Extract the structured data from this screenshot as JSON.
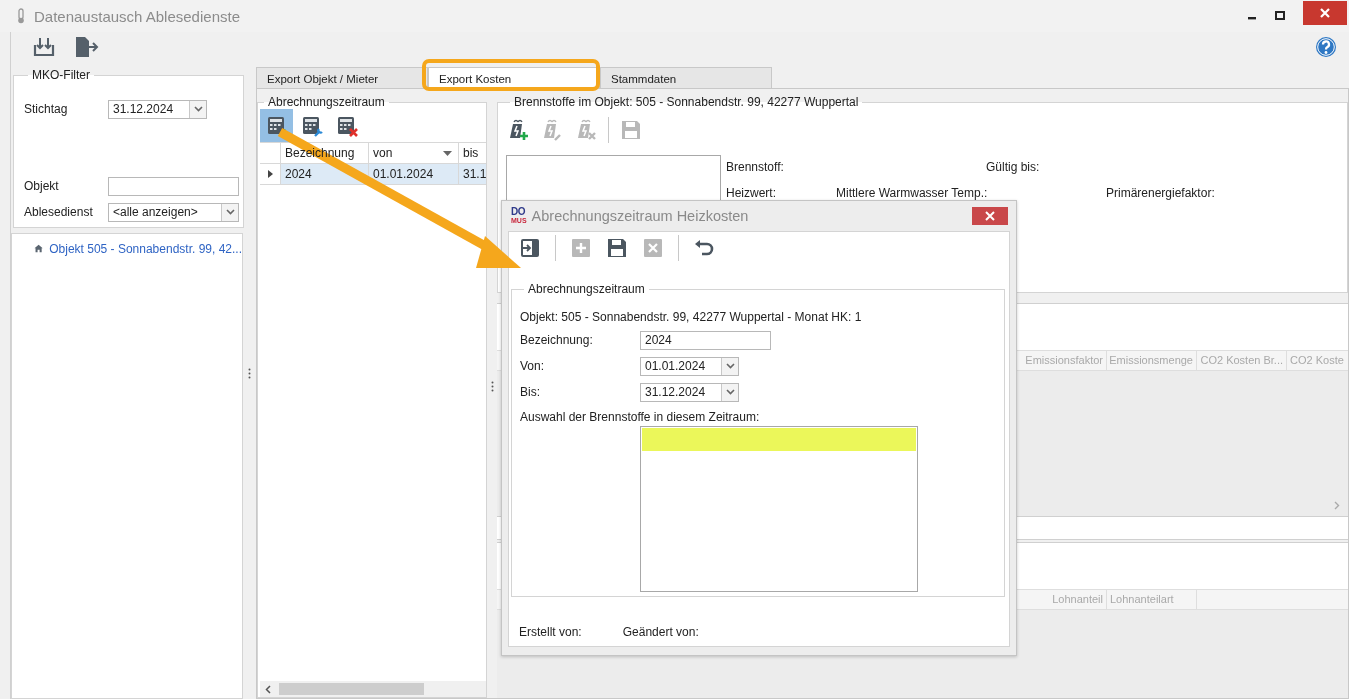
{
  "window": {
    "title": "Datenaustausch Ablesedienste"
  },
  "toolbar": [
    {
      "kind": "import"
    },
    {
      "kind": "export"
    }
  ],
  "filter": {
    "title": "MKO-Filter",
    "fields": [
      {
        "label": "Stichtag",
        "value": "31.12.2024",
        "kind": "combo"
      },
      {
        "label": "Objekt",
        "kind": "text"
      },
      {
        "label": "Ablesedienst",
        "value": "<alle anzeigen>",
        "kind": "combo"
      }
    ]
  },
  "tree": {
    "items": [
      {
        "label": "Objekt 505 - Sonnabendstr. 99, 42..."
      }
    ]
  },
  "tabs": [
    {
      "label": "Export Objekt / Mieter",
      "selected": false
    },
    {
      "label": "Export Kosten",
      "selected": true
    },
    {
      "label": "Stammdaten",
      "selected": false
    }
  ],
  "periods": {
    "title": "Abrechnungszeitraum",
    "tools": [
      {
        "kind": "add",
        "selected": true
      },
      {
        "kind": "edit",
        "selected": false
      },
      {
        "kind": "delete",
        "selected": false
      }
    ],
    "columns": [
      "Bezeichnung",
      "von",
      "bis"
    ],
    "rows": [
      {
        "cells": [
          "2024",
          "01.01.2024",
          "31.1"
        ],
        "selected": true
      }
    ]
  },
  "fuels": {
    "title": "Brennstoffe im Objekt: 505 - Sonnabendstr. 99, 42277 Wuppertal",
    "tools": [
      {
        "kind": "add",
        "disabled": false
      },
      {
        "kind": "edit",
        "disabled": true
      },
      {
        "kind": "delete",
        "disabled": true
      },
      {
        "kind": "save",
        "disabled": true
      }
    ],
    "labels": [
      "Brennstoff:",
      "Gültig bis:",
      "Heizwert:",
      "Mittlere Warmwasser Temp.:",
      "Primärenergiefaktor:"
    ]
  },
  "grid_1": {
    "columns": [
      "Emissionsfaktor",
      "Emissionsmenge",
      "CO2 Kosten Br...",
      "CO2 Koste"
    ]
  },
  "grid_2": {
    "columns": [
      "Lohnanteil",
      "Lohnanteilart"
    ]
  },
  "dialog": {
    "logo_top": "DO",
    "logo_bottom": "MUS",
    "title": "Abrechnungszeitraum Heizkosten",
    "tools": [
      {
        "kind": "exit",
        "disabled": false
      },
      {
        "kind": "add",
        "disabled": true
      },
      {
        "kind": "save",
        "disabled": false
      },
      {
        "kind": "delete",
        "disabled": true
      },
      {
        "kind": "undo",
        "disabled": false
      }
    ],
    "group_title": "Abrechnungszeitraum",
    "info": "Objekt: 505 - Sonnabendstr. 99, 42277 Wuppertal - Monat HK: 1",
    "fields": [
      {
        "label": "Bezeichnung:",
        "value": "2024",
        "kind": "text"
      },
      {
        "label": "Von:",
        "value": "01.01.2024",
        "kind": "combo"
      },
      {
        "label": "Bis:",
        "value": "31.12.2024",
        "kind": "combo"
      }
    ],
    "list_label": "Auswahl der Brennstoffe in diesem Zeitraum:",
    "list_rows": [
      {
        "selected": true
      }
    ],
    "footer": [
      "Erstellt von:",
      "Geändert von:"
    ]
  }
}
